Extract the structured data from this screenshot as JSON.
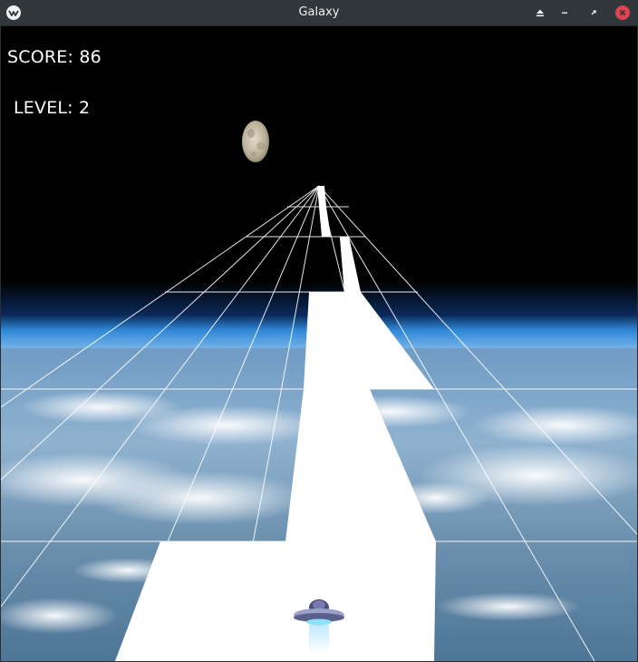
{
  "window": {
    "title": "Galaxy",
    "icons": {
      "app": "kivy-logo-icon",
      "keep_above": "eject-icon",
      "minimize": "minimize-icon",
      "maximize": "restore-icon",
      "close": "close-icon"
    },
    "colors": {
      "titlebar": "#31363b",
      "close": "#da4453"
    }
  },
  "hud": {
    "score": "SCORE: 86",
    "level": "LEVEL: 2"
  },
  "scene": {
    "background": "earth-from-orbit",
    "moon": "moon",
    "ship": "ufo-ship",
    "grid_color": "#ffffff",
    "path_color": "#ffffff"
  }
}
